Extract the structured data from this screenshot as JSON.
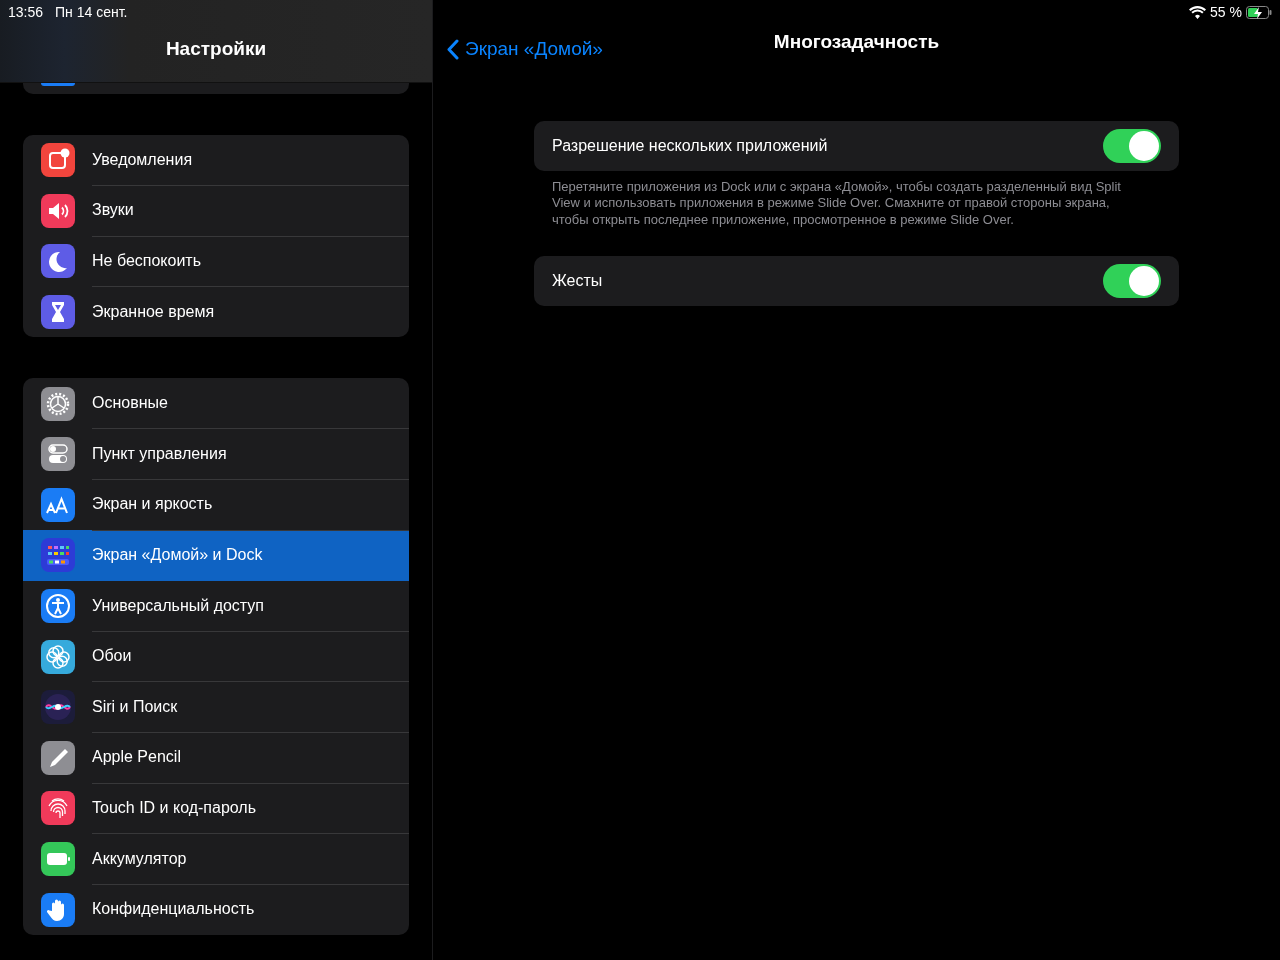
{
  "status_bar": {
    "time": "13:56",
    "date": "Пн 14 сент.",
    "battery": "55 %"
  },
  "sidebar": {
    "title": "Настройки",
    "groups": [
      {
        "items": [
          {
            "label": "Уведомления",
            "kind": "notifications",
            "color": "#f2453d",
            "selected": false
          },
          {
            "label": "Звуки",
            "kind": "sounds",
            "color": "#f03a5a",
            "selected": false
          },
          {
            "label": "Не беспокоить",
            "kind": "moon",
            "color": "#5e5ce6",
            "selected": false
          },
          {
            "label": "Экранное время",
            "kind": "hourglass",
            "color": "#5e5ce6",
            "selected": false
          }
        ]
      },
      {
        "items": [
          {
            "label": "Основные",
            "kind": "gear",
            "color": "#8e8e93",
            "selected": false
          },
          {
            "label": "Пункт управления",
            "kind": "switches",
            "color": "#8e8e93",
            "selected": false
          },
          {
            "label": "Экран и яркость",
            "kind": "aa",
            "color": "#1a7cf5",
            "selected": false
          },
          {
            "label": "Экран «Домой» и Dock",
            "kind": "grid",
            "color": "#2d3bd6",
            "selected": true
          },
          {
            "label": "Универсальный доступ",
            "kind": "person",
            "color": "#1a7cf5",
            "selected": false
          },
          {
            "label": "Обои",
            "kind": "flower",
            "color": "#36aadc",
            "selected": false
          },
          {
            "label": "Siri и Поиск",
            "kind": "siri",
            "color": "#1c1c3a",
            "selected": false
          },
          {
            "label": "Apple Pencil",
            "kind": "pencil",
            "color": "#8e8e93",
            "selected": false
          },
          {
            "label": "Touch ID и код-пароль",
            "kind": "fingerprint",
            "color": "#f03a5a",
            "selected": false
          },
          {
            "label": "Аккумулятор",
            "kind": "battery",
            "color": "#34c759",
            "selected": false
          },
          {
            "label": "Конфиденциальность",
            "kind": "hand",
            "color": "#1a7cf5",
            "selected": false
          }
        ]
      }
    ]
  },
  "detail": {
    "back": "Экран «Домой»",
    "title": "Многозадачность",
    "sections": [
      {
        "label": "Разрешение нескольких приложений",
        "on": true,
        "footer": "Перетяните приложения из Dock или с экрана «Домой», чтобы создать разделенный вид Split View и использовать приложения в режиме Slide Over. Смахните от правой стороны экрана, чтобы открыть последнее приложение, просмотренное в режиме Slide Over."
      },
      {
        "label": "Жесты",
        "on": true
      }
    ]
  }
}
